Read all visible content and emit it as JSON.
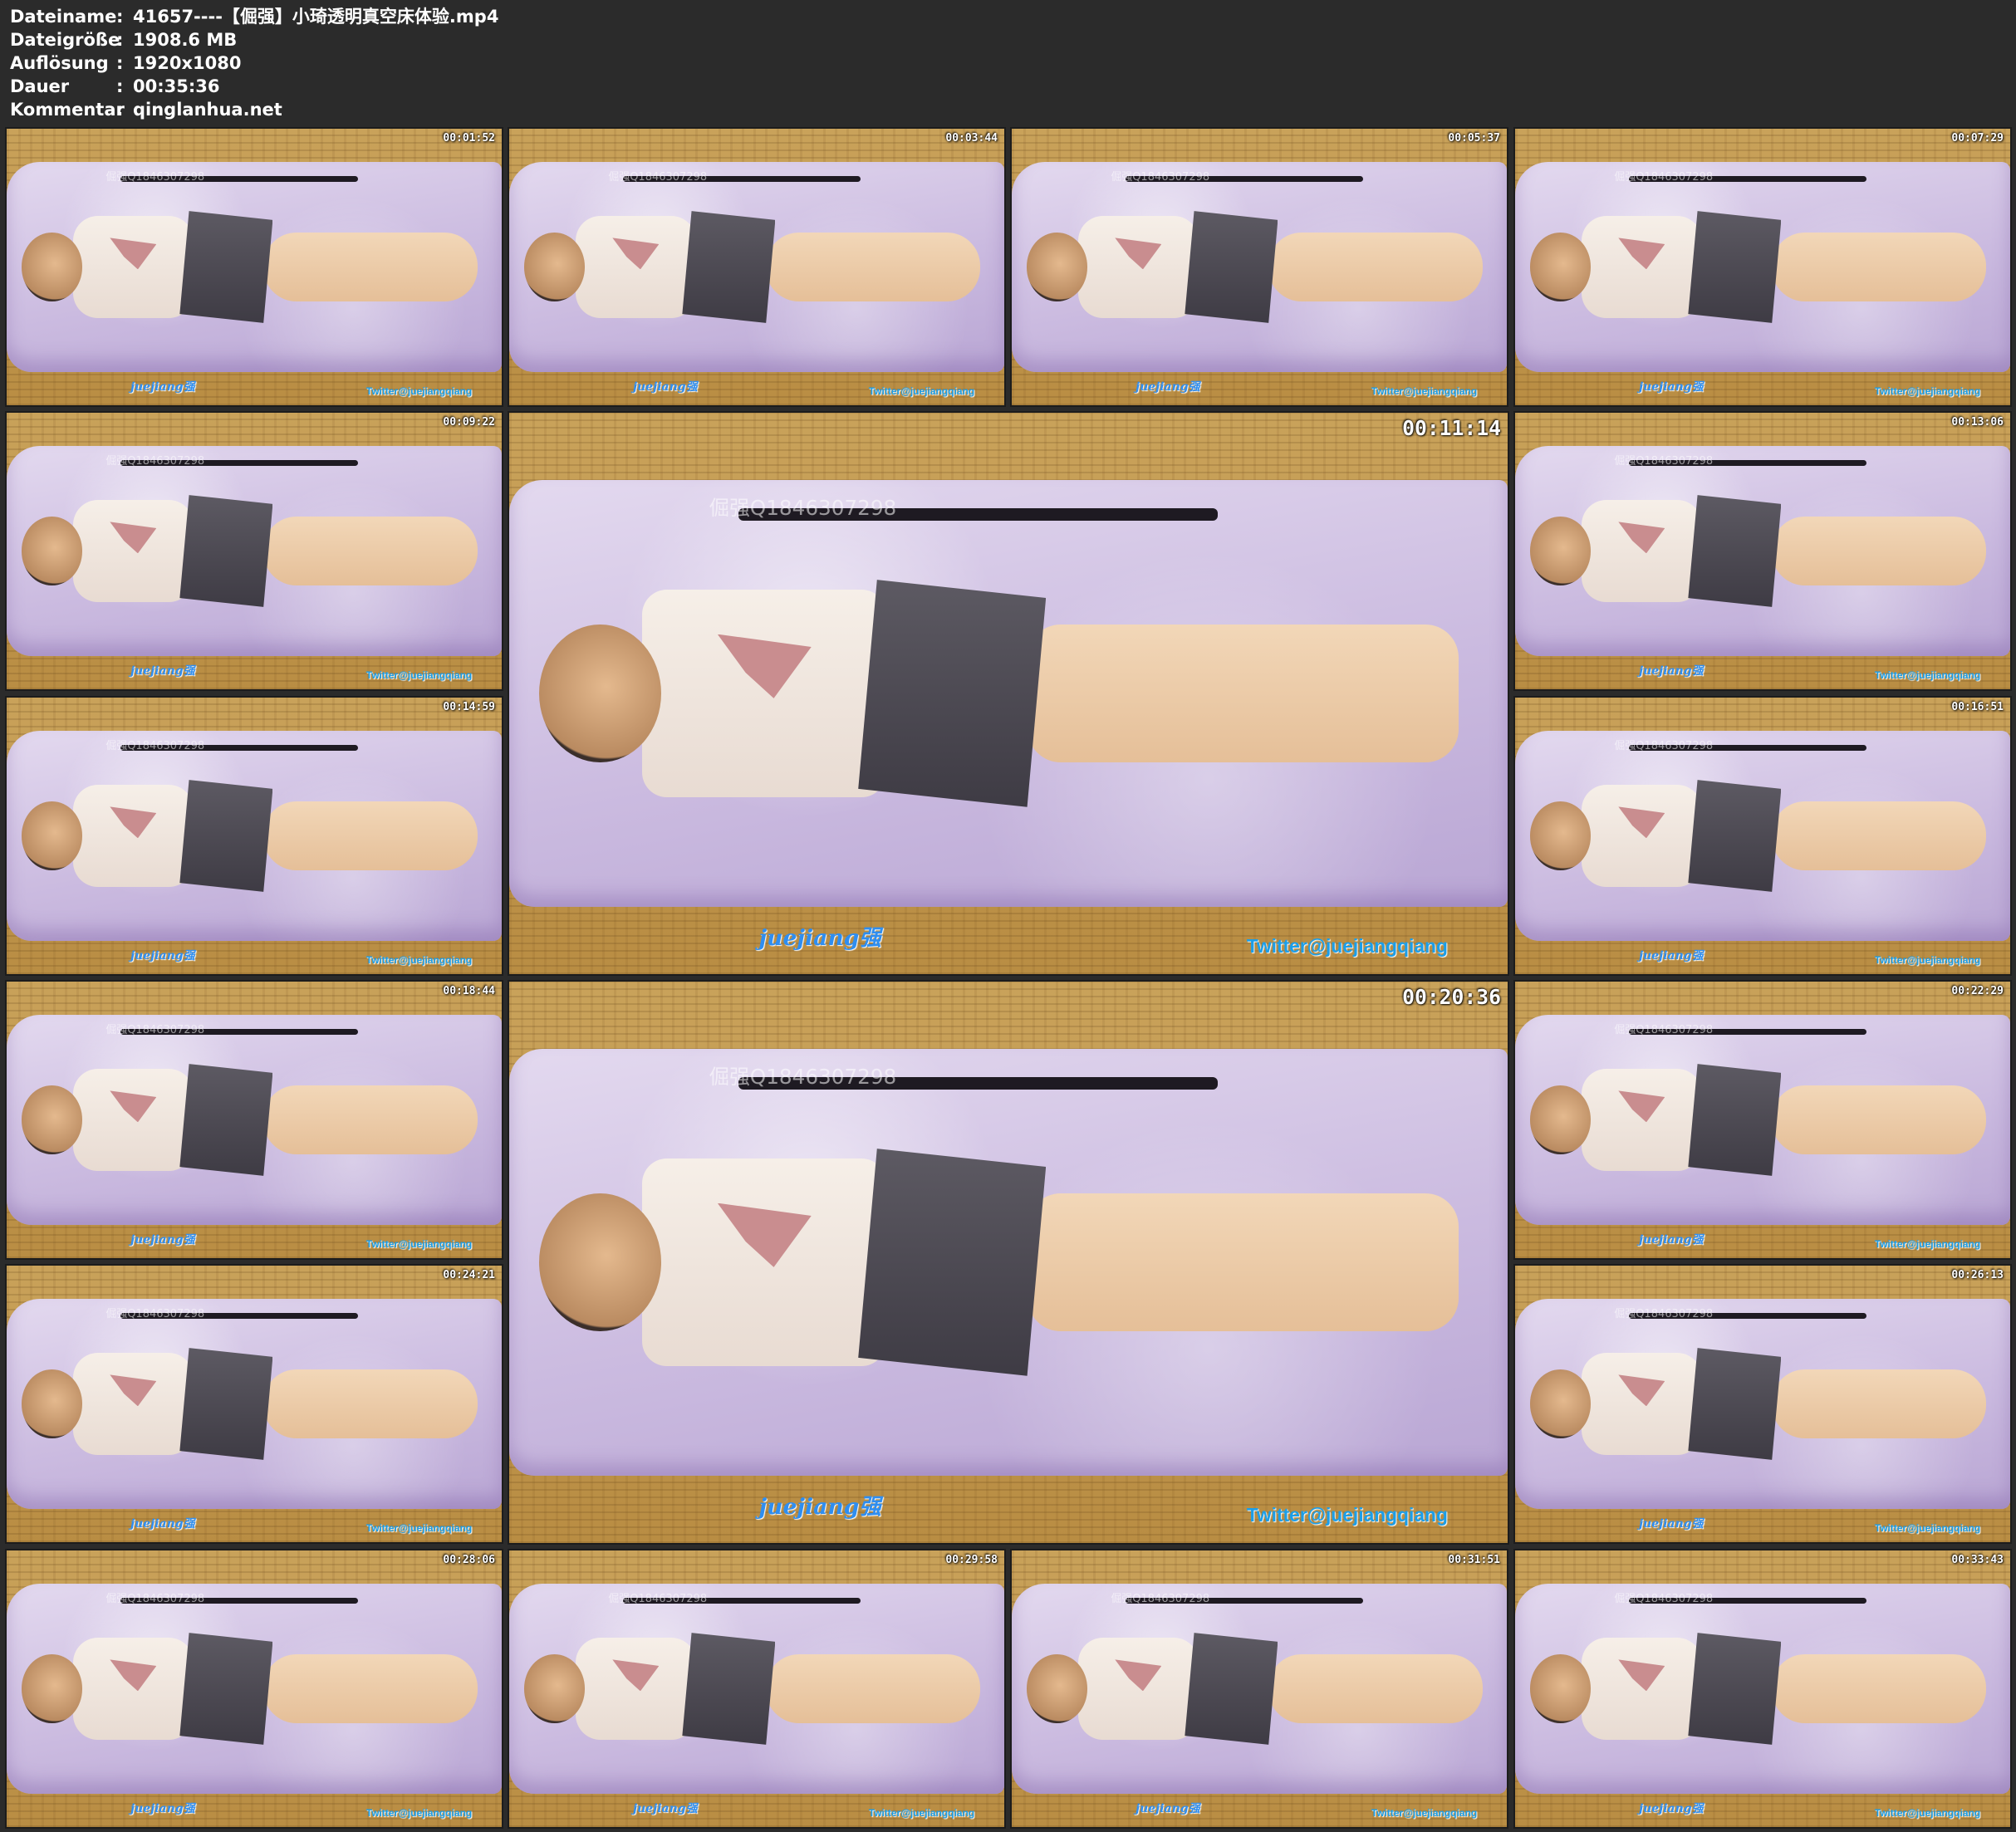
{
  "header": {
    "rows": [
      {
        "label": "Dateiname",
        "sep": ":",
        "value": "41657----【倔强】小琦透明真空床体验.mp4"
      },
      {
        "label": "Dateigröße",
        "sep": ":",
        "value": "1908.6 MB"
      },
      {
        "label": "Auflösung",
        "sep": ":",
        "value": "1920x1080"
      },
      {
        "label": "Dauer",
        "sep": ":",
        "value": "00:35:36"
      },
      {
        "label": "Kommentar",
        "sep": ":",
        "value": "qinglanhua.net"
      }
    ]
  },
  "watermarks": {
    "left": "juejiang强",
    "right": "Twitter@juejiangqiang",
    "qq": "倔强Q1846307298"
  },
  "thumbnails": [
    {
      "timestamp": "00:01:52"
    },
    {
      "timestamp": "00:03:44"
    },
    {
      "timestamp": "00:05:37"
    },
    {
      "timestamp": "00:07:29"
    },
    {
      "timestamp": "00:09:22"
    },
    {
      "timestamp": "00:11:14"
    },
    {
      "timestamp": "00:13:06"
    },
    {
      "timestamp": "00:14:59"
    },
    {
      "timestamp": "00:16:51"
    },
    {
      "timestamp": "00:18:44"
    },
    {
      "timestamp": "00:20:36"
    },
    {
      "timestamp": "00:22:29"
    },
    {
      "timestamp": "00:24:21"
    },
    {
      "timestamp": "00:26:13"
    },
    {
      "timestamp": "00:28:06"
    },
    {
      "timestamp": "00:29:58"
    },
    {
      "timestamp": "00:31:51"
    },
    {
      "timestamp": "00:33:43"
    }
  ]
}
